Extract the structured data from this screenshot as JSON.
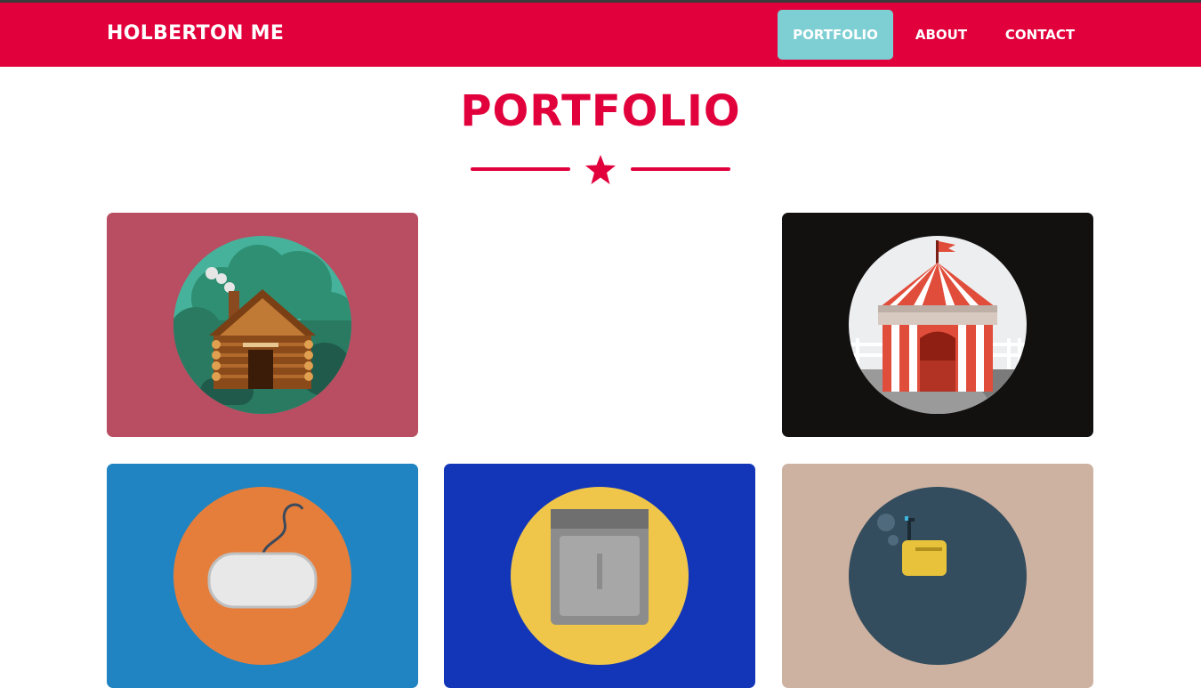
{
  "navbar": {
    "brand": "HOLBERTON ME",
    "links": [
      {
        "label": "PORTFOLIO",
        "active": true
      },
      {
        "label": "ABOUT",
        "active": false
      },
      {
        "label": "CONTACT",
        "active": false
      }
    ]
  },
  "main": {
    "title": "PORTFOLIO",
    "divider_icon": "star-icon"
  },
  "portfolio": {
    "items": [
      {
        "icon": "cabin-icon",
        "background": "#b94d61"
      },
      {
        "icon": "circus-tent-icon",
        "background": "#131010"
      },
      {
        "icon": "game-controller-icon",
        "background": "#1f84c1"
      },
      {
        "icon": "safe-icon",
        "background": "#1336b8"
      },
      {
        "icon": "submarine-icon",
        "background": "#ceb2a1"
      }
    ]
  },
  "colors": {
    "brand": "#e1003b",
    "active_nav": "#7ecfd3"
  }
}
